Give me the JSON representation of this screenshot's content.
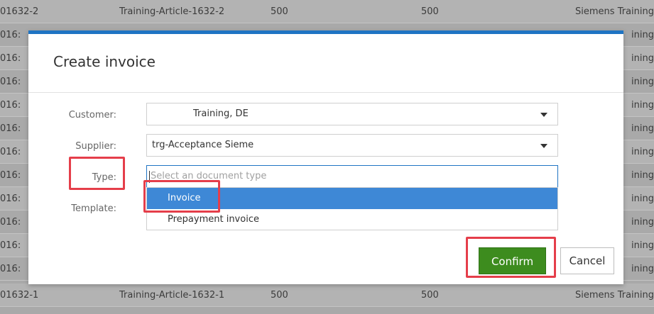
{
  "background_table": {
    "top_row": {
      "id": "01632-2",
      "article": "Training-Article-1632-2",
      "qty1": "500",
      "qty2": "500",
      "org": "Siemens Training"
    },
    "middle_rows": [
      {
        "id": "016:",
        "org": "ining"
      },
      {
        "id": "016:",
        "org": "ining"
      },
      {
        "id": "016:",
        "org": "ining"
      },
      {
        "id": "016:",
        "org": "ining"
      },
      {
        "id": "016:",
        "org": "ining"
      },
      {
        "id": "016:",
        "org": "ining"
      },
      {
        "id": "016:",
        "org": "ining"
      },
      {
        "id": "016:",
        "org": "ining"
      },
      {
        "id": "016:",
        "org": "ining"
      },
      {
        "id": "016:",
        "org": "ining"
      },
      {
        "id": "016:",
        "org": "ining"
      }
    ],
    "bottom_row": {
      "id": "01632-1",
      "article": "Training-Article-1632-1",
      "qty1": "500",
      "qty2": "500",
      "org": "Siemens Training"
    }
  },
  "dialog": {
    "title": "Create invoice",
    "accent_color": "#1f74c3",
    "customer": {
      "label": "Customer:",
      "value": "Training, DE"
    },
    "supplier": {
      "label": "Supplier:",
      "value": "trg-Acceptance Sieme"
    },
    "type": {
      "label": "Type:",
      "placeholder": "Select an document type",
      "options": [
        "Invoice",
        "Prepayment invoice"
      ],
      "highlighted_option": "Invoice"
    },
    "template": {
      "label": "Template:"
    },
    "confirm_label": "Confirm",
    "cancel_label": "Cancel",
    "confirm_color": "#3d8c1e"
  },
  "annotation_color": "#e53e4a"
}
